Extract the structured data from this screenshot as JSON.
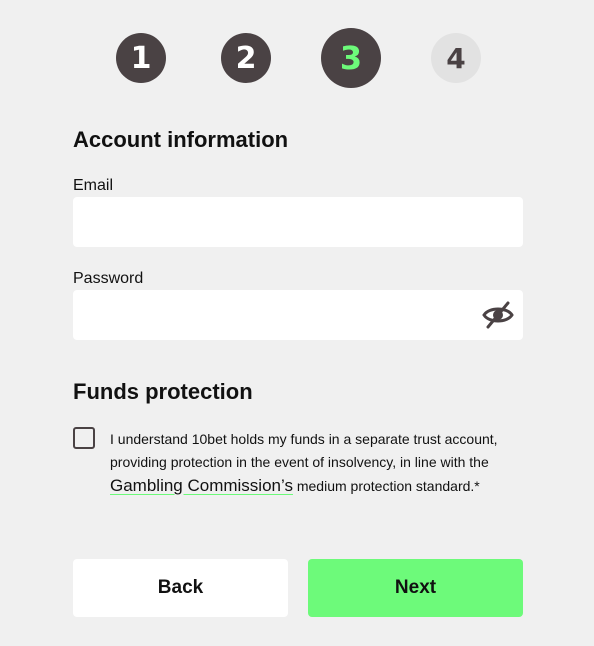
{
  "stepper": {
    "steps": [
      {
        "number": "1",
        "state": "completed"
      },
      {
        "number": "2",
        "state": "completed"
      },
      {
        "number": "3",
        "state": "current"
      },
      {
        "number": "4",
        "state": "upcoming"
      }
    ]
  },
  "account": {
    "title": "Account information",
    "email_label": "Email",
    "email_value": "",
    "password_label": "Password",
    "password_value": "",
    "password_toggle_icon": "eye-slash-icon"
  },
  "funds": {
    "title": "Funds protection",
    "checkbox_checked": false,
    "text_before_link": "I understand 10bet holds my funds in a separate trust account, providing protection in the event of insolvency, in line with the ",
    "link_text": "Gambling Commission’s",
    "text_after_link": " medium protection standard.*"
  },
  "actions": {
    "back_label": "Back",
    "next_label": "Next"
  },
  "colors": {
    "background": "#f0f0f0",
    "step_dark": "#4a4244",
    "step_inactive": "#e2e2e2",
    "accent_green": "#6dfa7a",
    "input_bg": "#ffffff"
  }
}
